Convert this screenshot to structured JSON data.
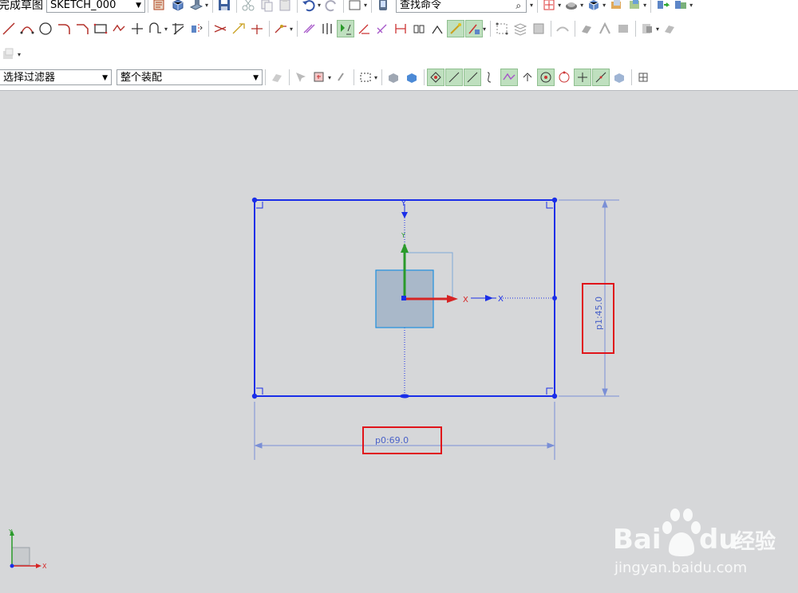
{
  "toolbar": {
    "finish_sketch_label": "完成草图",
    "sketch_name": "SKETCH_000",
    "command_search_placeholder": "查找命令",
    "selection_filter": "选择过滤器",
    "assembly_scope": "整个装配"
  },
  "sketch": {
    "dimensions": {
      "horizontal": "p0:69.0",
      "vertical": "p1:45.0"
    },
    "axis_labels": {
      "x": "X",
      "y": "Y"
    }
  },
  "colors": {
    "sketch_line": "#1a2ee8",
    "dimension_line": "#7a8fd6",
    "highlight_box": "#e0141a",
    "x_axis": "#d62424",
    "y_axis": "#2a9a2a",
    "background": "#d6d7d9"
  }
}
